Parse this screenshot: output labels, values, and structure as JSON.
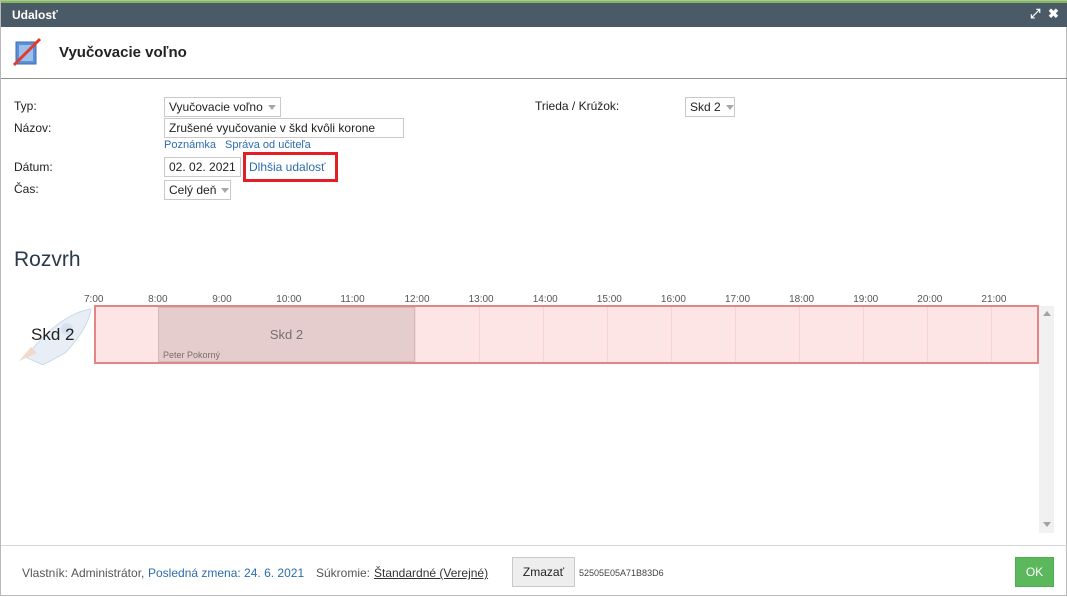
{
  "window": {
    "title": "Udalosť"
  },
  "event": {
    "heading": "Vyučovacie voľno"
  },
  "form": {
    "type_label": "Typ:",
    "type_value": "Vyučovacie voľno",
    "name_label": "Názov:",
    "name_value": "Zrušené vyučovanie v škd kvôli korone",
    "note_link": "Poznámka",
    "teacher_message_link": "Správa od učiteľa",
    "date_label": "Dátum:",
    "date_value": "02. 02. 2021",
    "longer_event_link": "Dlhšia udalosť",
    "time_label": "Čas:",
    "time_value": "Celý deň",
    "class_label": "Trieda / Krúžok:",
    "class_value": "Skd 2"
  },
  "schedule": {
    "title": "Rozvrh",
    "hours": [
      "7:00",
      "8:00",
      "9:00",
      "10:00",
      "11:00",
      "12:00",
      "13:00",
      "14:00",
      "15:00",
      "16:00",
      "17:00",
      "18:00",
      "19:00",
      "20:00",
      "21:00"
    ],
    "row_label": "Skd 2",
    "lesson": {
      "title": "Skd 2",
      "teacher": "Peter Pokorný"
    }
  },
  "footer": {
    "owner_label": "Vlastník:",
    "owner_value": "Administrátor,",
    "last_change": "Posledná zmena: 24. 6. 2021",
    "privacy_label": "Súkromie:",
    "privacy_value": "Štandardné (Verejné)",
    "delete_button": "Zmazať",
    "hash": "52505E05A71B83D6",
    "ok_button": "OK"
  },
  "colors": {
    "titlebar": "#4a5a66",
    "accent_green": "#7cbf4a",
    "highlight_red": "#e41e25",
    "ok_green": "#5cb85c",
    "link_blue": "#2b6cb0"
  }
}
